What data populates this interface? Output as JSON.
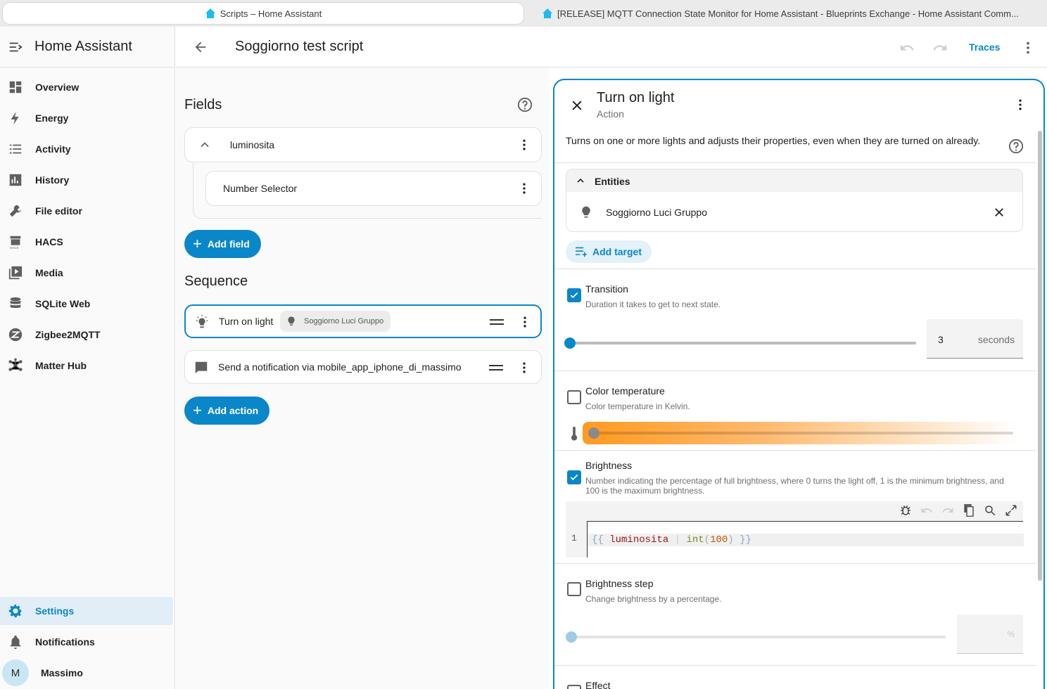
{
  "browser": {
    "tabs": [
      {
        "title": "Scripts – Home Assistant"
      },
      {
        "title": "[RELEASE] MQTT Connection State Monitor for Home Assistant - Blueprints Exchange - Home Assistant Comm..."
      }
    ]
  },
  "sidebar": {
    "title": "Home Assistant",
    "items": [
      {
        "label": "Overview",
        "icon": "overview-icon"
      },
      {
        "label": "Energy",
        "icon": "lightning-icon"
      },
      {
        "label": "Activity",
        "icon": "list-icon"
      },
      {
        "label": "History",
        "icon": "chart-icon"
      },
      {
        "label": "File editor",
        "icon": "wrench-icon"
      },
      {
        "label": "HACS",
        "icon": "hacs-icon"
      },
      {
        "label": "Media",
        "icon": "media-icon"
      },
      {
        "label": "SQLite Web",
        "icon": "database-icon"
      },
      {
        "label": "Zigbee2MQTT",
        "icon": "zigbee-icon"
      },
      {
        "label": "Matter Hub",
        "icon": "hub-icon"
      }
    ],
    "settings": "Settings",
    "notifications": "Notifications",
    "user": {
      "initial": "M",
      "name": "Massimo"
    }
  },
  "topbar": {
    "title": "Soggiorno test script",
    "traces": "Traces"
  },
  "fields": {
    "heading": "Fields",
    "field_name": "luminosita",
    "selector": "Number Selector",
    "add_field": "Add field"
  },
  "sequence": {
    "heading": "Sequence",
    "actions": [
      {
        "label": "Turn on light",
        "chip": "Soggiorno Luci Gruppo"
      },
      {
        "label": "Send a notification via mobile_app_iphone_di_massimo"
      }
    ],
    "add_action": "Add action"
  },
  "panel": {
    "title": "Turn on light",
    "subtitle": "Action",
    "description": "Turns on one or more lights and adjusts their properties, even when they are turned on already.",
    "entities_heading": "Entities",
    "entity": "Soggiorno Luci Gruppo",
    "add_target": "Add target",
    "transition": {
      "label": "Transition",
      "help": "Duration it takes to get to next state.",
      "value": "3",
      "unit": "seconds",
      "checked": true,
      "slider_level": 0
    },
    "color_temp": {
      "label": "Color temperature",
      "help": "Color temperature in Kelvin.",
      "checked": false
    },
    "brightness": {
      "label": "Brightness",
      "help": "Number indicating the percentage of full brightness, where 0 turns the light off, 1 is the minimum brightness, and 100 is the maximum brightness.",
      "checked": true,
      "line_no": "1",
      "code": {
        "open": "{{",
        "var": "luminosita",
        "pipe": "|",
        "fn": "int",
        "lp": "(",
        "num": "100",
        "rp": ")",
        "close": "}}"
      }
    },
    "brightness_step": {
      "label": "Brightness step",
      "help": "Change brightness by a percentage.",
      "unit": "%",
      "checked": false
    },
    "effect": {
      "label": "Effect"
    }
  },
  "colors": {
    "accent": "#0a87c9"
  }
}
